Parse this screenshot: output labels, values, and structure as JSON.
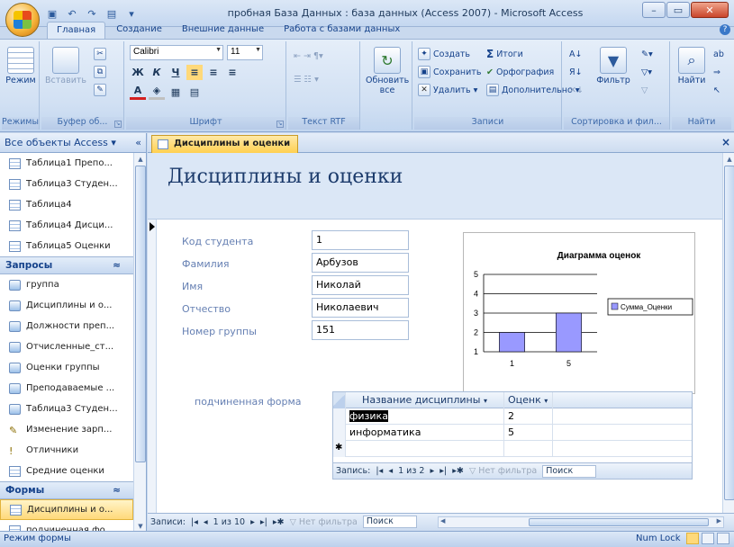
{
  "window": {
    "title": "пробная База Данных : база данных (Access 2007) - Microsoft Access"
  },
  "ribbon": {
    "tabs": [
      "Главная",
      "Создание",
      "Внешние данные",
      "Работа с базами данных"
    ],
    "groups": {
      "views": {
        "label": "Режимы",
        "view_btn": "Режим"
      },
      "clipboard": {
        "label": "Буфер об...",
        "paste_btn": "Вставить"
      },
      "font": {
        "label": "Шрифт",
        "font_name": "Calibri",
        "font_size": "11"
      },
      "rtf": {
        "label": "Текст RTF"
      },
      "refresh": {
        "btn_line1": "Обновить",
        "btn_line2": "все"
      },
      "records": {
        "label": "Записи",
        "new": "Создать",
        "save": "Сохранить",
        "delete": "Удалить",
        "totals": "Итоги",
        "spelling": "Орфография",
        "more": "Дополнительно"
      },
      "sort": {
        "label": "Сортировка и фил...",
        "filter": "Фильтр"
      },
      "find": {
        "label": "Найти",
        "find_btn": "Найти"
      }
    }
  },
  "nav": {
    "header": "Все объекты Access",
    "tables": [
      "Таблица1 Препо...",
      "Таблица3 Студен...",
      "Таблица4",
      "Таблица4 Дисци...",
      "Таблица5 Оценки"
    ],
    "queries_group": "Запросы",
    "queries": [
      "группа",
      "Дисциплины и о...",
      "Должности преп...",
      "Отчисленные_ст...",
      "Оценки группы",
      "Преподаваемые ...",
      "Таблица3 Студен...",
      "Изменение зарп...",
      "Отличники",
      "Средние оценки"
    ],
    "forms_group": "Формы",
    "forms": [
      "Дисциплины и о...",
      "подчиненная фо..."
    ]
  },
  "document": {
    "tab_title": "Дисциплины и оценки",
    "form_title": "Дисциплины и оценки",
    "fields": [
      {
        "label": "Код студента",
        "value": "1"
      },
      {
        "label": "Фамилия",
        "value": "Арбузов"
      },
      {
        "label": "Имя",
        "value": "Николай"
      },
      {
        "label": "Отчество",
        "value": "Николаевич"
      },
      {
        "label": "Номер группы",
        "value": "151"
      }
    ],
    "subform_label": "подчиненная форма",
    "subform": {
      "columns": [
        "Название дисциплины",
        "Оценк"
      ],
      "rows": [
        [
          "физика",
          "2"
        ],
        [
          "информатика",
          "5"
        ]
      ],
      "nav": {
        "prefix": "Запись:",
        "counter": "1 из 2",
        "no_filter": "Нет фильтра",
        "search": "Поиск"
      }
    },
    "main_nav": {
      "prefix": "Записи:",
      "counter": "1 из 10",
      "no_filter": "Нет фильтра",
      "search": "Поиск"
    }
  },
  "chart_data": {
    "type": "bar",
    "title": "Диаграмма оценок",
    "categories": [
      "1",
      "5"
    ],
    "series": [
      {
        "name": "Сумма_Оценки",
        "values": [
          2,
          3
        ]
      }
    ],
    "ylim": [
      1,
      5
    ],
    "yticks": [
      "1",
      "2",
      "3",
      "4",
      "5"
    ],
    "grid": true,
    "legend": "right",
    "color": "#9999ff"
  },
  "status": {
    "left": "Режим формы",
    "numlock": "Num Lock"
  }
}
